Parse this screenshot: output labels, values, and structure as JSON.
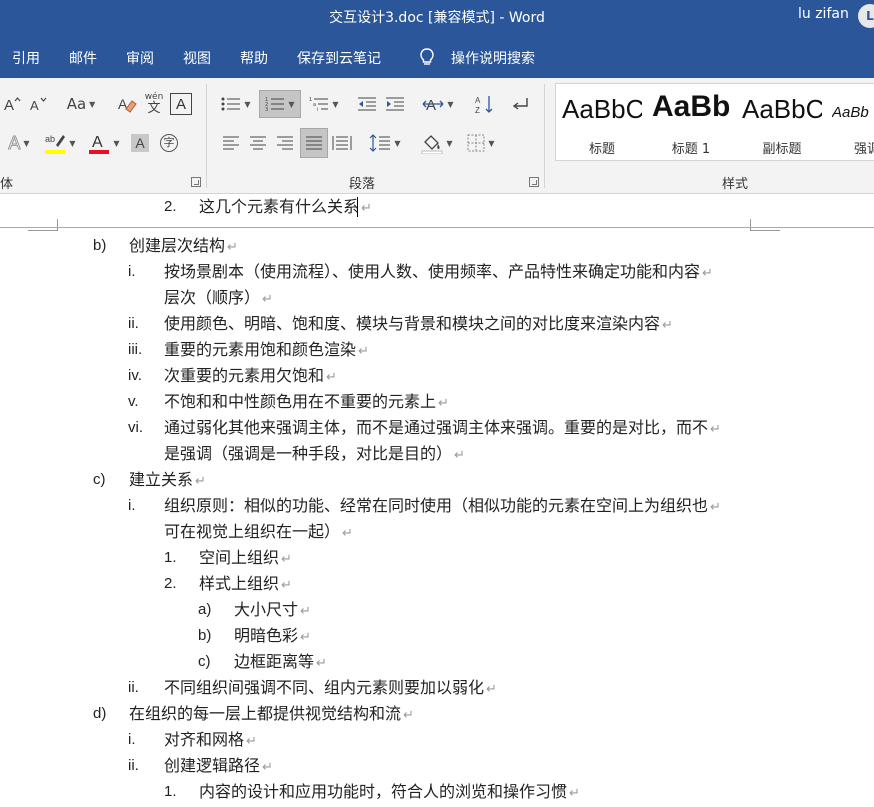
{
  "window": {
    "title": "交互设计3.doc [兼容模式]  -  Word",
    "user_name": "lu zifan",
    "user_initial": "L"
  },
  "tabs": [
    {
      "label": "引用"
    },
    {
      "label": "邮件"
    },
    {
      "label": "审阅"
    },
    {
      "label": "视图"
    },
    {
      "label": "帮助"
    },
    {
      "label": "保存到云笔记"
    },
    {
      "label": "操作说明搜索"
    }
  ],
  "ribbon": {
    "font_group_label": "体",
    "paragraph_group_label": "段落",
    "styles_group_label": "样式",
    "font_size_label": "Aa",
    "pinyin_label": "wén",
    "styles": [
      {
        "sample": "AaBbC",
        "name": "标题"
      },
      {
        "sample": "AaBb",
        "name": "标题 1"
      },
      {
        "sample": "AaBbC",
        "name": "副标题"
      },
      {
        "sample": "AaBb",
        "name": "强调"
      }
    ],
    "colors": {
      "highlight": "#ffff00",
      "font_color": "#e81123",
      "accent": "#2b579a"
    }
  },
  "document": {
    "lines": [
      {
        "marker": "2.",
        "text": "这几个元素有什么关系"
      },
      {
        "marker": "b)",
        "text": "创建层次结构"
      },
      {
        "marker": "i.",
        "text": "按场景剧本（使用流程）、使用人数、使用频率、产品特性来确定功能和内容"
      },
      {
        "marker": "",
        "text": "层次（顺序）"
      },
      {
        "marker": "ii.",
        "text": "使用颜色、明暗、饱和度、模块与背景和模块之间的对比度来渲染内容"
      },
      {
        "marker": "iii.",
        "text": "重要的元素用饱和颜色渲染"
      },
      {
        "marker": "iv.",
        "text": "次重要的元素用欠饱和"
      },
      {
        "marker": "v.",
        "text": "不饱和和中性颜色用在不重要的元素上"
      },
      {
        "marker": "vi.",
        "text": "通过弱化其他来强调主体，而不是通过强调主体来强调。重要的是对比，而不"
      },
      {
        "marker": "",
        "text": "是强调（强调是一种手段，对比是目的）"
      },
      {
        "marker": "c)",
        "text": "建立关系"
      },
      {
        "marker": "i.",
        "text": "组织原则：相似的功能、经常在同时使用（相似功能的元素在空间上为组织也"
      },
      {
        "marker": "",
        "text": "可在视觉上组织在一起）"
      },
      {
        "marker": "1.",
        "text": "空间上组织"
      },
      {
        "marker": "2.",
        "text": "样式上组织"
      },
      {
        "marker": "a)",
        "text": "大小尺寸"
      },
      {
        "marker": "b)",
        "text": "明暗色彩"
      },
      {
        "marker": "c)",
        "text": "边框距离等"
      },
      {
        "marker": "ii.",
        "text": "不同组织间强调不同、组内元素则要加以弱化"
      },
      {
        "marker": "d)",
        "text": "在组织的每一层上都提供视觉结构和流"
      },
      {
        "marker": "i.",
        "text": "对齐和网格"
      },
      {
        "marker": "ii.",
        "text": "创建逻辑路径"
      },
      {
        "marker": "1.",
        "text": "内容的设计和应用功能时，符合人的浏览和操作习惯"
      }
    ],
    "paragraph_mark": "↵"
  }
}
